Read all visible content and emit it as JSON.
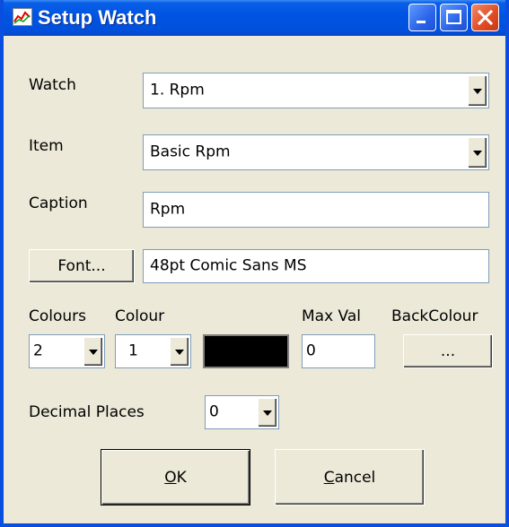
{
  "window": {
    "title": "Setup Watch",
    "title_icon": "chart-icon",
    "controls": [
      "minimize-icon",
      "maximize-icon",
      "close-icon"
    ]
  },
  "watch": {
    "label": "Watch",
    "value": "1. Rpm"
  },
  "item": {
    "label": "Item",
    "value": "Basic Rpm"
  },
  "caption": {
    "label": "Caption",
    "value": "Rpm"
  },
  "font": {
    "button_label": "Font...",
    "value": "48pt Comic Sans MS"
  },
  "colours": {
    "label": "Colours",
    "value": "2"
  },
  "colour": {
    "label": "Colour",
    "value": "1",
    "swatch_color": "#000000"
  },
  "max_val": {
    "label": "Max Val",
    "value": "0"
  },
  "back_colour": {
    "label": "BackColour",
    "button_label": "..."
  },
  "decimal_places": {
    "label": "Decimal Places",
    "value": "0"
  },
  "buttons": {
    "ok": {
      "accel": "O",
      "rest": "K"
    },
    "cancel": {
      "accel": "C",
      "rest": "ancel"
    }
  },
  "colors": {
    "titlebar": "#0054e3",
    "dialog_bg": "#ece9d8",
    "close": "#e04a24"
  }
}
